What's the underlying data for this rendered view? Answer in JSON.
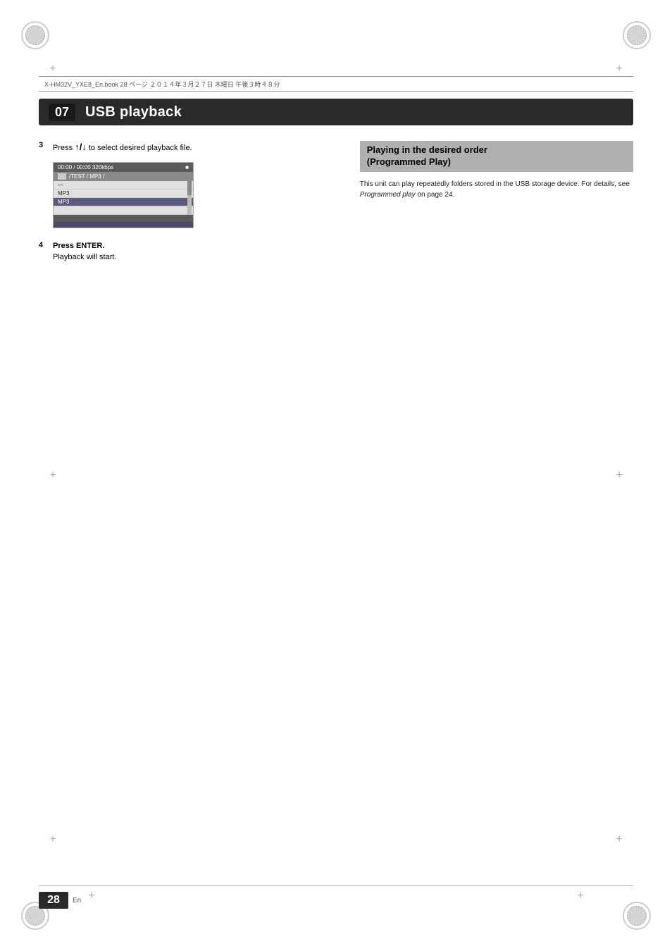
{
  "page": {
    "title": "USB playback",
    "chapter_number": "07",
    "page_number": "28",
    "page_lang": "En"
  },
  "header": {
    "file_info": "X-HM32V_YXE8_En.book   28  ページ   ２０１４年３月２７日   木曜日   午後３時４８分"
  },
  "steps": [
    {
      "number": "3",
      "text": "Press ",
      "key": "↑/↓",
      "text2": " to select desired playback file."
    },
    {
      "number": "4",
      "text": "Press ENTER.",
      "subtext": "Playback will start."
    }
  ],
  "screen": {
    "top_bar": "00:00 / 00:00  320kbps",
    "stop_icon": "■",
    "folder_path": "/TEST / MP3 /",
    "files": [
      {
        "name": "—",
        "selected": false
      },
      {
        "name": "MP3",
        "selected": false
      },
      {
        "name": "MP3",
        "selected": true
      },
      {
        "name": "   ",
        "selected": false
      }
    ]
  },
  "right_section": {
    "heading_line1": "Playing in the desired order",
    "heading_line2": "(Programmed Play)",
    "body": "This unit can play repeatedly folders stored in the USB storage device. For details, see ",
    "italic_text": "Programmed play",
    "body2": " on page 24."
  }
}
